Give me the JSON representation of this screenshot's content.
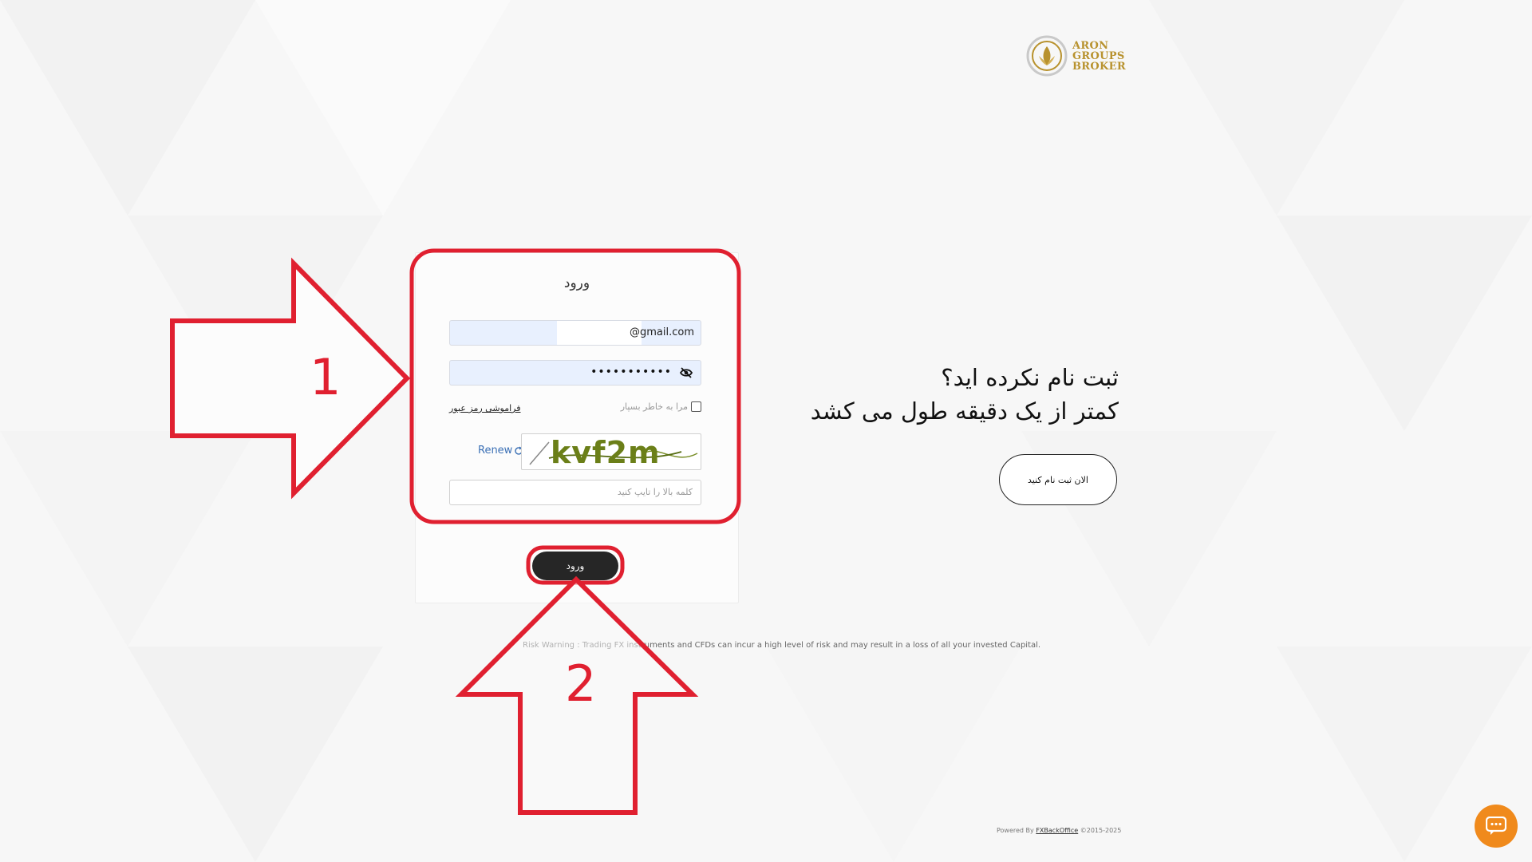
{
  "logo": {
    "line1": "ARON",
    "line2": "GROUPS",
    "line3": "BROKER"
  },
  "login": {
    "title": "ورود",
    "email_value": "@gmail.com",
    "password_value": "•••••••••••",
    "remember_label": "مرا به خاطر بسپار",
    "forgot_label": "فراموشی رمز عبور",
    "renew_label": "Renew",
    "captcha_text": "kvf2m",
    "captcha_placeholder": "کلمه بالا را تایپ کنید",
    "submit_label": "ورود"
  },
  "signup": {
    "line1": "ثبت نام نکرده اید؟",
    "line2": "کمتر از یک دقیقه طول می کشد",
    "button_label": "الان ثبت نام کنید"
  },
  "risk_warning": "Risk Warning : Trading FX instruments and CFDs can incur a high level of risk and may result in a loss of all your invested Capital.",
  "footer": {
    "powered_prefix": "Powered By",
    "powered_link": "FXBackOffice",
    "copyright": "©2015-2025"
  },
  "annotations": {
    "label1": "1",
    "label2": "2"
  },
  "colors": {
    "annotation": "#e02030",
    "chat": "#f08a1c",
    "accent_gold": "#b8922e"
  }
}
